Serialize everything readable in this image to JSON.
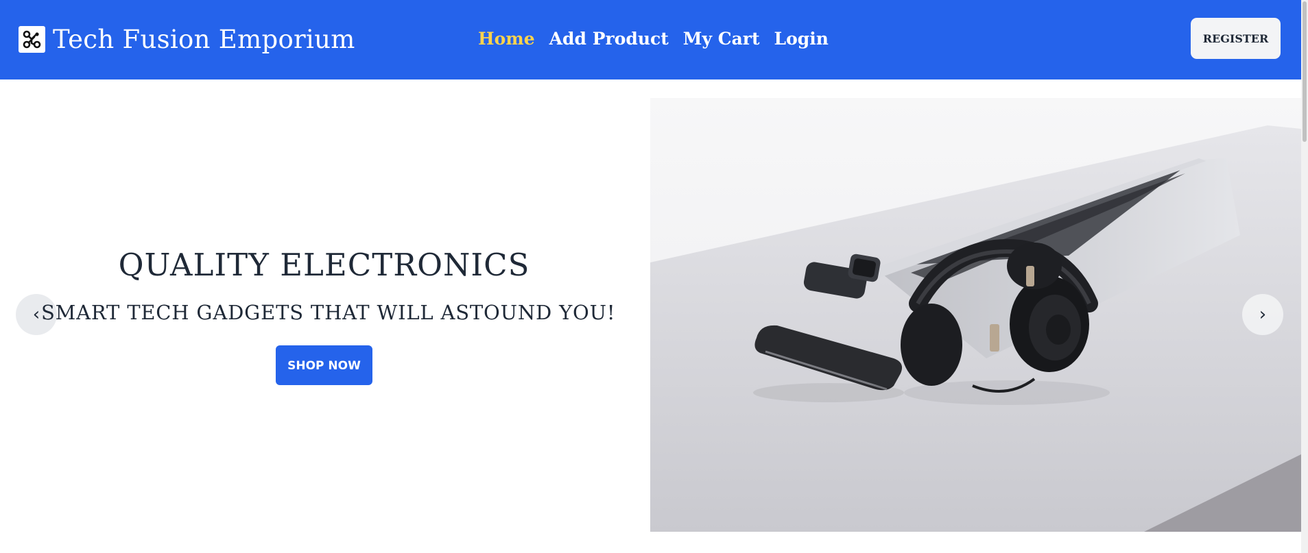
{
  "brand": {
    "name": "Tech Fusion Emporium",
    "logo_icon": "circuit-icon"
  },
  "nav": {
    "links": [
      {
        "label": "Home",
        "active": true
      },
      {
        "label": "Add Product",
        "active": false
      },
      {
        "label": "My Cart",
        "active": false
      },
      {
        "label": "Login",
        "active": false
      }
    ],
    "register_label": "REGISTER"
  },
  "hero": {
    "title": "QUALITY ELECTRONICS",
    "subtitle": "SMART TECH GADGETS THAT WILL ASTOUND YOU!",
    "cta_label": "SHOP NOW",
    "prev_glyph": "‹",
    "next_glyph": "›",
    "image_icon": "desk-gadgets-photo"
  },
  "colors": {
    "primary": "#2563eb",
    "active_link": "#fcd34d",
    "text_dark": "#1f2937"
  }
}
